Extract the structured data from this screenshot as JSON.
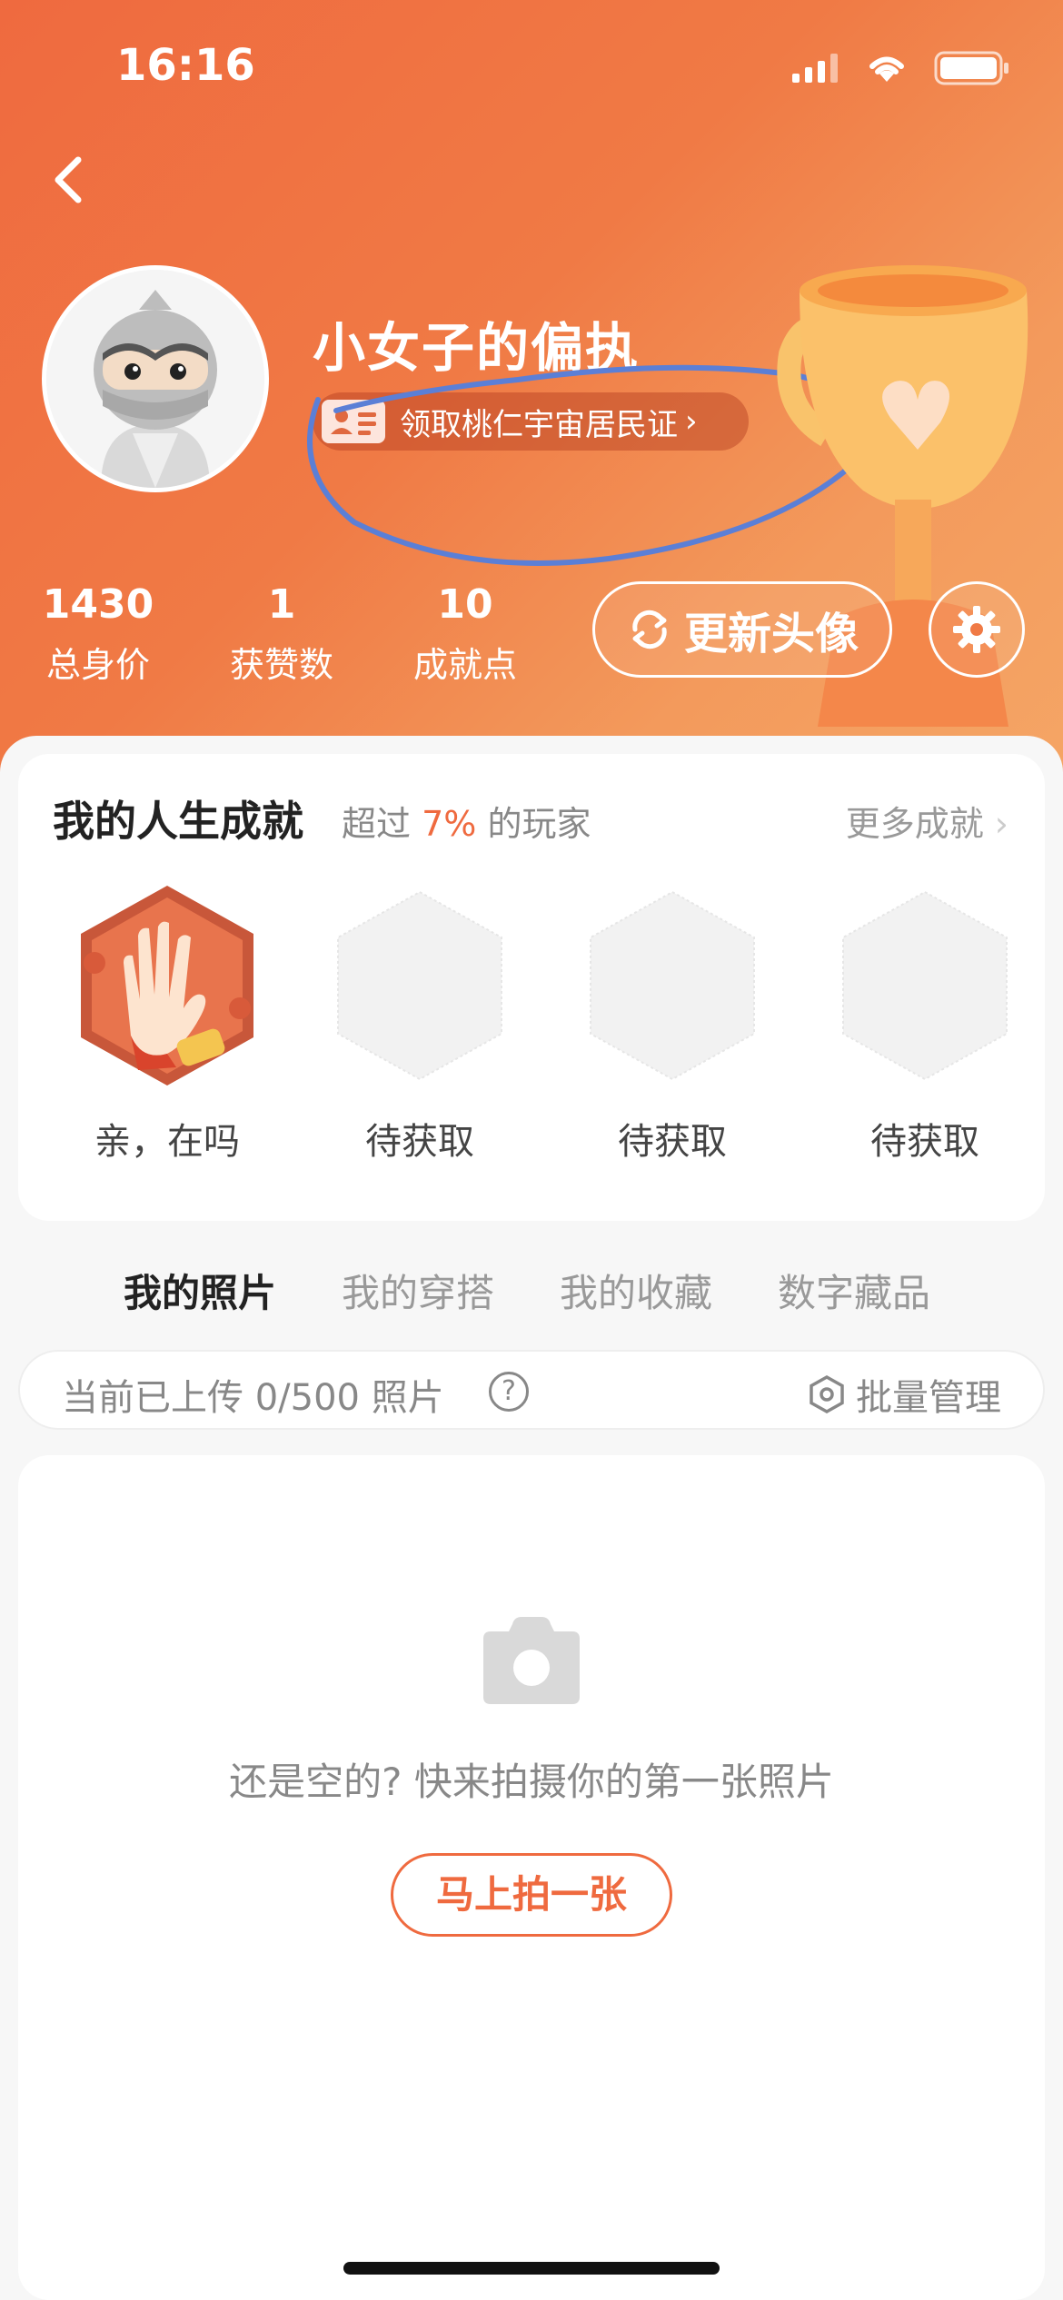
{
  "status_bar": {
    "time": "16:16"
  },
  "profile": {
    "username": "小女子的偏执",
    "id_pill_label": "领取桃仁宇宙居民证",
    "stats": [
      {
        "value": "1430",
        "label": "总身价"
      },
      {
        "value": "1",
        "label": "获赞数"
      },
      {
        "value": "10",
        "label": "成就点"
      }
    ],
    "update_avatar_label": "更新头像"
  },
  "achievements": {
    "title": "我的人生成就",
    "subtitle_prefix": "超过",
    "subtitle_percent": "7%",
    "subtitle_suffix": "的玩家",
    "more_label": "更多成就",
    "badges": [
      {
        "label": "亲，在吗",
        "earned": true
      },
      {
        "label": "待获取",
        "earned": false
      },
      {
        "label": "待获取",
        "earned": false
      },
      {
        "label": "待获取",
        "earned": false
      }
    ]
  },
  "tabs": [
    {
      "label": "我的照片",
      "active": true
    },
    {
      "label": "我的穿搭",
      "active": false
    },
    {
      "label": "我的收藏",
      "active": false
    },
    {
      "label": "数字藏品",
      "active": false
    }
  ],
  "upload_bar": {
    "text": "当前已上传 0/500 照片",
    "help": "?",
    "manage_label": "批量管理"
  },
  "empty_state": {
    "message": "还是空的? 快来拍摄你的第一张照片",
    "button_label": "马上拍一张"
  },
  "colors": {
    "accent": "#ef6a3f",
    "annotation": "#5b7fd6"
  }
}
